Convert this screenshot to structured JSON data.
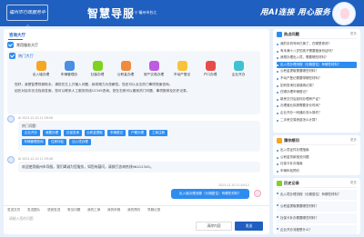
{
  "header": {
    "logo_text": "福州市行政服务中心",
    "title": "智慧导服",
    "location": "福州市台江",
    "slogan": "用AI连接 用心服务"
  },
  "chat": {
    "tab_label": "咨询大厅",
    "service_section_title": "常用服务大厅",
    "greeting": {
      "title": "热门大厅",
      "services": [
        {
          "label": "出入境办理",
          "color": "#f5a623"
        },
        {
          "label": "车辆管理办",
          "color": "#4a90e2"
        },
        {
          "label": "社保办理",
          "color": "#7ed321"
        },
        {
          "label": "公积金办理",
          "color": "#f08a3c"
        },
        {
          "label": "房产交易办理",
          "color": "#bd5ce0"
        },
        {
          "label": "不动产登记",
          "color": "#f8c33a"
        },
        {
          "label": "户口办理",
          "color": "#e94b4b"
        },
        {
          "label": "企业开办",
          "color": "#3ec1d3"
        }
      ],
      "text_lines": [
        "您好，我是智慧导服助手。请您在左上方输入问题，我将竭力为您解答。您还可以点击热门事项快速咨询。",
        "如在对话中无法找到答案，您可以联系人工服务热线12345咨询。您在右侧可以看到热门问题、事项推荐及历史记录。"
      ]
    },
    "message1_meta": "AI 2023-12-20 11:39:06",
    "hot": {
      "title": "热门问题：",
      "chips": [
        "企业开办",
        "我要办理",
        "社保查询",
        "公积金提取",
        "车辆登记",
        "户籍办理",
        "工商注册",
        "车辆管理查询",
        "住房补贴",
        "出入境办理"
      ]
    },
    "message2_meta": "AI 2023-12-20 11:39:48",
    "welcome_text": "欢迎使用福州市导服，我们竭诚为您服务，如您有疑问，请拨打咨询热线96412345。",
    "user_message": "出入境办理流程（长期居住）有哪些材料？",
    "user_meta": "2023-12-20 11:40:12",
    "toolbar": [
      "发送文件",
      "发送图片",
      "语音发送",
      "常见问题",
      "我的工单",
      "我的申报",
      "我的预约",
      "导服记录"
    ],
    "input_placeholder": "请输入您的问题",
    "clear_label": "清除内容",
    "send_label": "发送"
  },
  "hot_panel": {
    "title": "热点问题",
    "more": "更多",
    "items": [
      "我的手机号码已换了，在哪里修改?",
      "有未满十八岁的孩子需要做身份证吗？",
      "我想办理出入境，需要哪些材料？",
      "出入境办理流程（长期居住）有哪些材料？",
      "公积金提取需要哪些材料？",
      "不动产登记需要带哪些材料？",
      "如何查询社保缴纳记录？",
      "在哪办理车辆登记？",
      "新房交付后如何办理房产证？",
      "办理营业执照需要多长时间？",
      "企业开办一网通办怎么操作？",
      "二手房交易税费怎么计算？"
    ],
    "highlighted_index": 3
  },
  "recommend_panel": {
    "title": "猜你想问",
    "more": "更多",
    "items": [
      "出入境证件办理指南",
      "公积金贷款相关问题",
      "社保卡补办指南",
      "车辆年检预约"
    ]
  },
  "history_panel": {
    "title": "历史记录",
    "more": "更多",
    "items": [
      "出入境办理流程（长期居住）有哪些材料？",
      "公积金提取需要哪些材料？",
      "社保卡补办需要哪些材料？",
      "企业开办流程是什么？"
    ]
  }
}
